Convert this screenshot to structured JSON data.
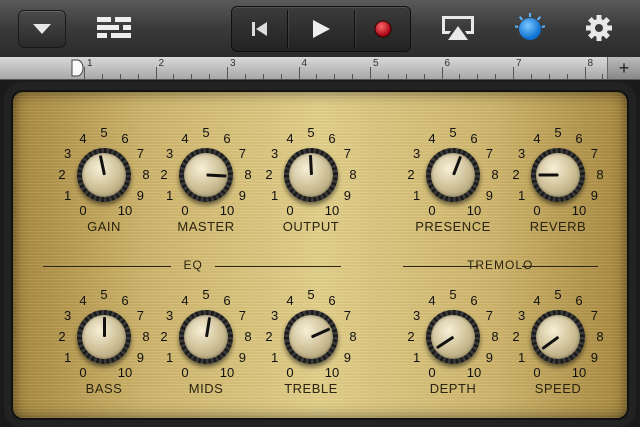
{
  "toolbar": {
    "menu_icon": "chevron-down-icon",
    "tracks_icon": "tracks-view-icon",
    "prev_icon": "skip-to-start-icon",
    "play_icon": "play-icon",
    "record_icon": "record-icon",
    "airplay_icon": "airplay-icon",
    "smart_controls_icon": "smart-controls-knob-icon",
    "settings_icon": "gear-icon",
    "record_color": "#d8141c",
    "active_color": "#2f9bff"
  },
  "ruler": {
    "bars": [
      "1",
      "2",
      "3",
      "4",
      "5",
      "6",
      "7",
      "8"
    ],
    "add_label": "+"
  },
  "knob_scale": [
    "0",
    "1",
    "2",
    "3",
    "4",
    "5",
    "6",
    "7",
    "8",
    "9",
    "10"
  ],
  "knobs": {
    "gain": {
      "label": "GAIN",
      "value": 4.6
    },
    "master": {
      "label": "MASTER",
      "value": 8.1
    },
    "output": {
      "label": "OUTPUT",
      "value": 4.9
    },
    "presence": {
      "label": "PRESENCE",
      "value": 5.7
    },
    "reverb": {
      "label": "REVERB",
      "value": 2.0
    },
    "bass": {
      "label": "BASS",
      "value": 5.0
    },
    "mids": {
      "label": "MIDS",
      "value": 5.3
    },
    "treble": {
      "label": "TREBLE",
      "value": 7.2
    },
    "depth": {
      "label": "DEPTH",
      "value": 0.9
    },
    "speed": {
      "label": "SPEED",
      "value": 0.8
    }
  },
  "sections": {
    "eq": "EQ",
    "tremolo": "TREMOLO"
  }
}
